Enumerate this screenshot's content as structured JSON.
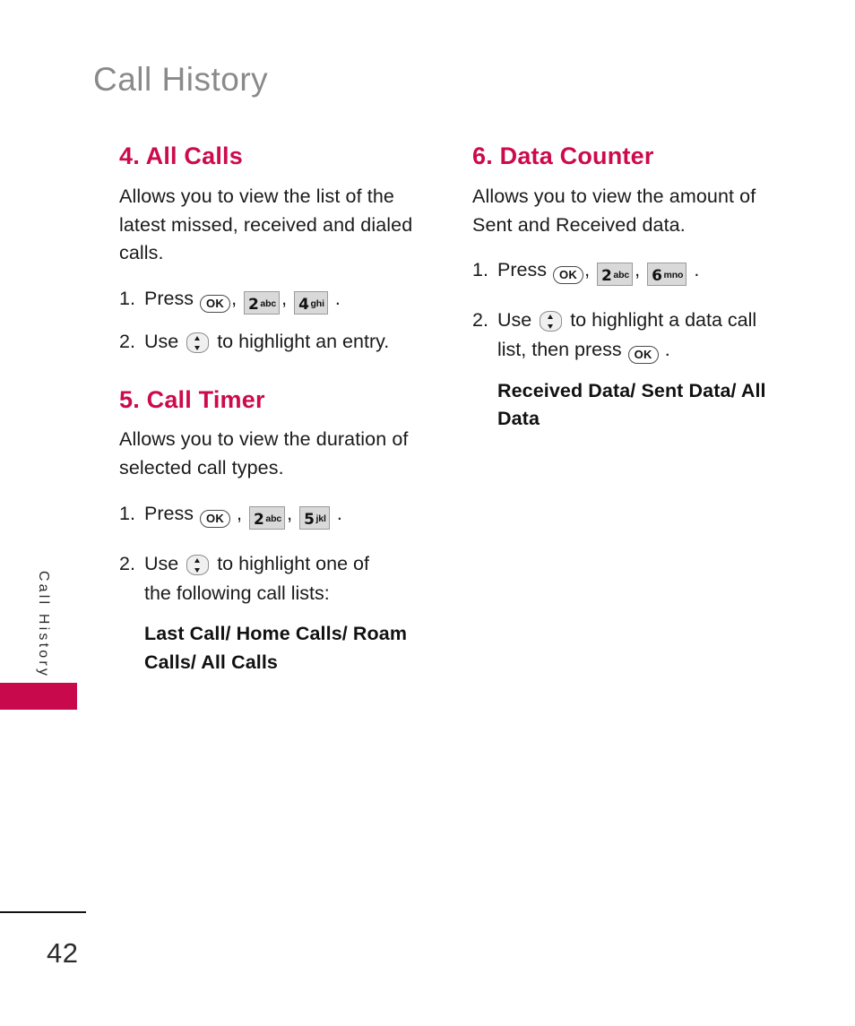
{
  "page": {
    "header_title": "Call History",
    "side_tab_label": "Call History",
    "page_number": "42",
    "accent_color": "#cc0a4d",
    "header_color": "#8a8a8a",
    "tab_color": "#c80a4d"
  },
  "keys": {
    "ok": "OK",
    "two": {
      "digit": "2",
      "letters": "abc"
    },
    "four": {
      "digit": "4",
      "letters": "ghi"
    },
    "five": {
      "digit": "5",
      "letters": "jkl"
    },
    "six": {
      "digit": "6",
      "letters": "mno"
    },
    "nav_icon": "navigation-up-down-key"
  },
  "columns": {
    "left": [
      {
        "title": "4. All Calls",
        "description": "Allows you to view the list of the latest missed, received and dialed calls.",
        "steps": [
          {
            "num": "1.",
            "pre": "Press",
            "sep1": ",",
            "sep2": ",",
            "end": "."
          },
          {
            "num": "2.",
            "pre": "Use",
            "post": "to highlight an entry."
          }
        ]
      },
      {
        "title": "5. Call Timer",
        "description": "Allows you to view the duration of selected call types.",
        "steps": [
          {
            "num": "1.",
            "pre": "Press",
            "sep1": ",",
            "sep2": ",",
            "end": "."
          },
          {
            "num": "2.",
            "pre": "Use",
            "post": "to highlight one of",
            "cont": "the following call lists:"
          }
        ],
        "bold_list": "Last Call/ Home Calls/ Roam Calls/ All Calls"
      }
    ],
    "right": [
      {
        "title": "6. Data Counter",
        "description": "Allows you to view the amount of Sent and Received data.",
        "steps": [
          {
            "num": "1.",
            "pre": "Press",
            "sep1": ",",
            "sep2": ",",
            "end": "."
          },
          {
            "num": "2.",
            "pre": "Use",
            "post": "to highlight a data call",
            "cont_pre": "list, then press",
            "cont_end": "."
          }
        ],
        "bold_list": "Received Data/ Sent Data/ All Data"
      }
    ]
  }
}
